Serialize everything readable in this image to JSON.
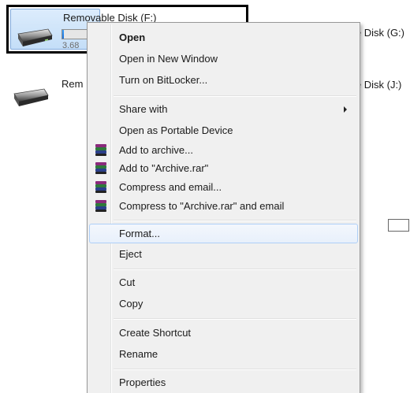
{
  "explorer": {
    "drive_f": {
      "name": "Removable Disk (F:)",
      "size_text": "3.68",
      "used_fraction": 0.05
    },
    "drive_second": {
      "name_visible": "Rem"
    },
    "label_g_visible": "le Disk (G:)",
    "label_j_visible": "le Disk (J:)"
  },
  "context_menu": {
    "open": "Open",
    "open_new_window": "Open in New Window",
    "bitlocker": "Turn on BitLocker...",
    "share_with": "Share with",
    "open_portable": "Open as Portable Device",
    "add_archive": "Add to archive...",
    "add_archive_rar": "Add to \"Archive.rar\"",
    "compress_email": "Compress and email...",
    "compress_rar_email": "Compress to \"Archive.rar\" and email",
    "format": "Format...",
    "eject": "Eject",
    "cut": "Cut",
    "copy": "Copy",
    "create_shortcut": "Create Shortcut",
    "rename": "Rename",
    "properties": "Properties"
  },
  "icons": {
    "drive": "usb-drive-icon",
    "winrar": "winrar-icon",
    "submenu": "submenu-arrow-icon"
  },
  "colors": {
    "selection_bg": "#c4def8",
    "selection_border": "#84acdd",
    "hover_border": "#aecff7",
    "menu_bg": "#f0f0f0",
    "progress_fill": "#1b6fd6"
  }
}
